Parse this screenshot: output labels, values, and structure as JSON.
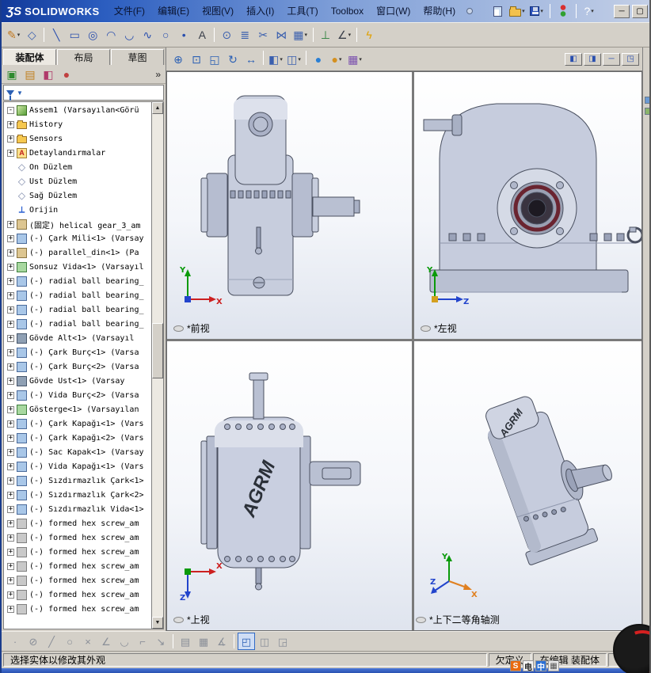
{
  "titlebar": {
    "logo_mark": "ƷS",
    "brand": "SOLIDWORKS",
    "menus": [
      "文件(F)",
      "编辑(E)",
      "视图(V)",
      "插入(I)",
      "工具(T)",
      "Toolbox",
      "窗口(W)",
      "帮助(H)"
    ],
    "window_controls": [
      {
        "name": "minimize-button",
        "glyph": "─"
      },
      {
        "name": "maximize-button",
        "glyph": "▢"
      }
    ]
  },
  "toolbars": {
    "standard": [
      {
        "name": "new-document-icon",
        "shape": "page"
      },
      {
        "name": "open-document-icon",
        "shape": "folder",
        "drop": true
      },
      {
        "name": "save-icon",
        "shape": "disk",
        "drop": true
      },
      {
        "sep": true
      },
      {
        "name": "toolbox-indicator-icon",
        "shape": "dots"
      },
      {
        "sep": true
      },
      {
        "name": "help-icon",
        "glyph": "?",
        "c": "#ffffff",
        "drop": true
      }
    ],
    "sketch": [
      {
        "name": "sketch-icon",
        "glyph": "✎",
        "c": "#c07820",
        "drop": true
      },
      {
        "name": "smart-dimension-icon",
        "glyph": "◇",
        "c": "#3a5fae"
      },
      {
        "sep": true
      },
      {
        "name": "line-icon",
        "glyph": "╲",
        "c": "#2a4fae"
      },
      {
        "name": "rectangle-icon",
        "glyph": "▭",
        "c": "#2a4fae"
      },
      {
        "name": "circle-icon",
        "glyph": "◎",
        "c": "#2a4fae"
      },
      {
        "name": "centerpoint-arc-icon",
        "glyph": "◠",
        "c": "#2a4fae"
      },
      {
        "name": "tangent-arc-icon",
        "glyph": "◡",
        "c": "#2a4fae"
      },
      {
        "name": "spline-icon",
        "glyph": "∿",
        "c": "#2a4fae"
      },
      {
        "name": "ellipse-icon",
        "glyph": "○",
        "c": "#2a4fae"
      },
      {
        "name": "point-icon",
        "glyph": "•",
        "c": "#2a4fae"
      },
      {
        "name": "text-icon",
        "glyph": "A",
        "c": "#3a3f4a"
      },
      {
        "sep": true
      },
      {
        "name": "convert-entities-icon",
        "glyph": "⊙",
        "c": "#3a5fae"
      },
      {
        "name": "offset-entities-icon",
        "glyph": "≣",
        "c": "#3a5fae"
      },
      {
        "name": "trim-entities-icon",
        "glyph": "✂",
        "c": "#3a5fae"
      },
      {
        "name": "mirror-entities-icon",
        "glyph": "⋈",
        "c": "#3a5fae"
      },
      {
        "name": "linear-pattern-icon",
        "glyph": "▦",
        "c": "#3a5fae",
        "drop": true
      },
      {
        "sep": true
      },
      {
        "name": "display-relations-icon",
        "glyph": "⊥",
        "c": "#2a7f3a"
      },
      {
        "name": "quick-snaps-icon",
        "glyph": "∠",
        "c": "#3a3f4a",
        "drop": true
      },
      {
        "sep": true
      },
      {
        "name": "rapid-sketch-icon",
        "glyph": "ϟ",
        "c": "#e0a000"
      }
    ],
    "view": [
      {
        "name": "zoom-in-out-icon",
        "glyph": "⊕",
        "c": "#2a5fb4"
      },
      {
        "name": "zoom-to-area-icon",
        "glyph": "⊡",
        "c": "#2a5fb4"
      },
      {
        "name": "zoom-to-fit-icon",
        "glyph": "◱",
        "c": "#2a5fb4"
      },
      {
        "name": "rotate-view-icon",
        "glyph": "↻",
        "c": "#2a5fb4"
      },
      {
        "name": "pan-view-icon",
        "glyph": "↔",
        "c": "#2a5fb4"
      },
      {
        "sep": true
      },
      {
        "name": "view-orientation-icon",
        "glyph": "◧",
        "c": "#3a5fae",
        "drop": true
      },
      {
        "name": "display-style-icon",
        "glyph": "◫",
        "c": "#3a5fae",
        "drop": true
      },
      {
        "sep": true
      },
      {
        "name": "edit-appearance-icon",
        "glyph": "●",
        "c": "#2a7fd4"
      },
      {
        "name": "apply-scene-icon",
        "glyph": "●",
        "c": "#d49020",
        "drop": true
      },
      {
        "name": "view-settings-icon",
        "glyph": "▦",
        "c": "#7a4fae",
        "drop": true
      }
    ],
    "doc": [
      {
        "name": "viewport-previous-icon",
        "glyph": "◧"
      },
      {
        "name": "viewport-next-icon",
        "glyph": "◨"
      },
      {
        "name": "document-minimize-button",
        "glyph": "─"
      },
      {
        "name": "document-restore-button",
        "glyph": "◳"
      }
    ],
    "panel": [
      {
        "name": "feature-manager-tree-icon",
        "glyph": "▣",
        "c": "#2e8b2e"
      },
      {
        "name": "property-manager-icon",
        "glyph": "▤",
        "c": "#c08020"
      },
      {
        "name": "configuration-manager-icon",
        "glyph": "◧",
        "c": "#b03a6a"
      },
      {
        "name": "display-manager-icon",
        "glyph": "●",
        "c": "#c04040"
      }
    ],
    "assembly_bottom": [
      {
        "name": "pointer-icon",
        "glyph": "·"
      },
      {
        "name": "no-select-icon",
        "glyph": "⊘"
      },
      {
        "name": "line-tool-icon",
        "glyph": "╱"
      },
      {
        "name": "circle-tool-icon",
        "glyph": "○"
      },
      {
        "name": "erase-icon",
        "glyph": "×"
      },
      {
        "name": "angle-icon",
        "glyph": "∠"
      },
      {
        "name": "arc-icon",
        "glyph": "◡"
      },
      {
        "name": "corner-icon",
        "glyph": "⌐"
      },
      {
        "name": "offset-arrow-icon",
        "glyph": "↘"
      },
      {
        "sep": true
      },
      {
        "name": "ruler-icon",
        "glyph": "▤"
      },
      {
        "name": "grid-icon",
        "glyph": "▦"
      },
      {
        "name": "angle-snap-icon",
        "glyph": "∡"
      },
      {
        "sep": true
      },
      {
        "name": "four-view-button",
        "glyph": "◰",
        "active": true
      },
      {
        "name": "two-view-vertical-button",
        "glyph": "◫"
      },
      {
        "name": "two-view-horizontal-button",
        "glyph": "◲"
      }
    ]
  },
  "left_panel": {
    "tabs": [
      {
        "label": "装配体",
        "active": true
      },
      {
        "label": "布局",
        "active": false
      },
      {
        "label": "草图",
        "active": false
      }
    ],
    "overflow_chevron": "»",
    "tree": [
      {
        "label": "Assem1 (Varsayılan<Görü",
        "icon": "assembly",
        "exp": "-"
      },
      {
        "label": "History",
        "icon": "folder",
        "exp": "+"
      },
      {
        "label": "Sensors",
        "icon": "folder",
        "exp": "+"
      },
      {
        "label": "Detaylandırmalar",
        "icon": "ann",
        "exp": "+"
      },
      {
        "label": "Ön Düzlem",
        "icon": "plane",
        "exp": ""
      },
      {
        "label": "Üst Düzlem",
        "icon": "plane",
        "exp": ""
      },
      {
        "label": "Sağ Düzlem",
        "icon": "plane",
        "exp": ""
      },
      {
        "label": "Orijin",
        "icon": "origin",
        "exp": ""
      },
      {
        "label": "(固定) helical gear_3_am",
        "icon": "part",
        "exp": "+"
      },
      {
        "label": "(-) Çark Mili<1> (Varsay",
        "icon": "part-blue",
        "exp": "+"
      },
      {
        "label": "(-) parallel_din<1> (Pa",
        "icon": "part",
        "exp": "+"
      },
      {
        "label": "Sonsuz Vida<1> (Varsayıl",
        "icon": "part-green",
        "exp": "+"
      },
      {
        "label": "(-) radial ball bearing_",
        "icon": "part-blue",
        "exp": "+"
      },
      {
        "label": "(-) radial ball bearing_",
        "icon": "part-blue",
        "exp": "+"
      },
      {
        "label": "(-) radial ball bearing_",
        "icon": "part-blue",
        "exp": "+"
      },
      {
        "label": "(-) radial ball bearing_",
        "icon": "part-blue",
        "exp": "+"
      },
      {
        "label": "Gövde Alt<1> (Varsayıl",
        "icon": "part-dark",
        "exp": "+"
      },
      {
        "label": "(-) Çark Burç<1> (Varsa",
        "icon": "part-blue",
        "exp": "+"
      },
      {
        "label": "(-) Çark Burç<2> (Varsa",
        "icon": "part-blue",
        "exp": "+"
      },
      {
        "label": "Gövde Üst<1> (Varsay",
        "icon": "part-dark",
        "exp": "+"
      },
      {
        "label": "(-) Vida Burç<2> (Varsa",
        "icon": "part-blue",
        "exp": "+"
      },
      {
        "label": "Gösterge<1> (Varsayılan",
        "icon": "part-green",
        "exp": "+"
      },
      {
        "label": "(-) Çark Kapağı<1> (Vars",
        "icon": "part-blue",
        "exp": "+"
      },
      {
        "label": "(-) Çark Kapağı<2> (Vars",
        "icon": "part-blue",
        "exp": "+"
      },
      {
        "label": "(-) Sac Kapak<1> (Varsay",
        "icon": "part-blue",
        "exp": "+"
      },
      {
        "label": "(-) Vida Kapağı<1> (Vars",
        "icon": "part-blue",
        "exp": "+"
      },
      {
        "label": "(-) Sızdırmazlık Çark<1>",
        "icon": "part-blue",
        "exp": "+"
      },
      {
        "label": "(-) Sızdırmazlık Çark<2>",
        "icon": "part-blue",
        "exp": "+"
      },
      {
        "label": "(-) Sızdırmazlık Vida<1>",
        "icon": "part-blue",
        "exp": "+"
      },
      {
        "label": "(-) formed hex screw_am",
        "icon": "part-gray",
        "exp": "+"
      },
      {
        "label": "(-) formed hex screw_am",
        "icon": "part-gray",
        "exp": "+"
      },
      {
        "label": "(-) formed hex screw_am",
        "icon": "part-gray",
        "exp": "+"
      },
      {
        "label": "(-) formed hex screw_am",
        "icon": "part-gray",
        "exp": "+"
      },
      {
        "label": "(-) formed hex screw_am",
        "icon": "part-gray",
        "exp": "+"
      },
      {
        "label": "(-) formed hex screw_am",
        "icon": "part-gray",
        "exp": "+"
      },
      {
        "label": "(-) formed hex screw_am",
        "icon": "part-gray",
        "exp": "+"
      }
    ]
  },
  "viewports": [
    {
      "label": "*前视",
      "triad": {
        "up": "Y",
        "right": "X"
      }
    },
    {
      "label": "*左视",
      "triad": {
        "up": "Y",
        "right": "Z"
      }
    },
    {
      "label": "*上视",
      "engraving": "AGRM",
      "triad": {
        "right": "X",
        "down": "Z"
      }
    },
    {
      "label": "*上下二等角轴测",
      "engraving": "AGRM",
      "triad": {
        "up": "Y",
        "right": "X",
        "left": "Z"
      }
    }
  ],
  "colors": {
    "axis_x": "#cc2020",
    "axis_y": "#0a9a0a",
    "axis_z": "#2244cc",
    "accent": "#2a5fb4"
  },
  "status": {
    "message": "选择实体以修改其外观",
    "definition": "欠定义",
    "editing": "在编辑  装配体"
  },
  "ime": {
    "items": [
      {
        "name": "sogou-icon",
        "glyph": "S",
        "bg": "#e86a10",
        "c": "#ffffff"
      },
      {
        "name": "ime-mode-icon",
        "glyph": "电",
        "bg": "#f4f4f4",
        "c": "#222222"
      },
      {
        "name": "ime-lang-icon",
        "glyph": "中",
        "bg": "#2a6fd4",
        "c": "#ffffff"
      },
      {
        "name": "ime-keyboard-icon",
        "glyph": "▦",
        "bg": "#e8e8e8",
        "c": "#555555"
      }
    ]
  }
}
